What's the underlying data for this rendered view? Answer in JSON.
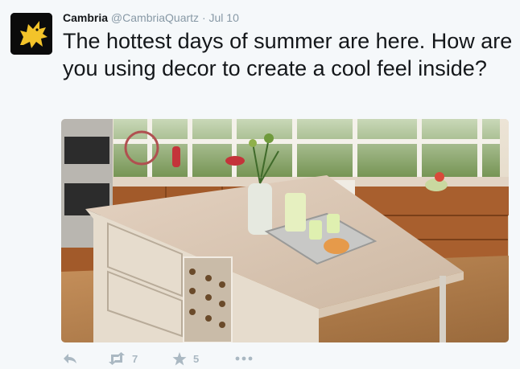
{
  "tweet": {
    "author_name": "Cambria",
    "handle": "@CambriaQuartz",
    "separator": "·",
    "date": "Jul 10",
    "text": "The hottest days of summer are here. How are you using decor to create a cool feel inside?"
  },
  "actions": {
    "reply_icon": "reply-icon",
    "retweet_icon": "retweet-icon",
    "retweet_count": "7",
    "favorite_icon": "star-icon",
    "favorite_count": "5",
    "more_icon": "more-icon"
  },
  "colors": {
    "avatar_bg": "#0b0b0b",
    "avatar_logo": "#f3c32a",
    "text": "#14171a",
    "muted": "#8899a6",
    "action": "#aab8c2"
  }
}
